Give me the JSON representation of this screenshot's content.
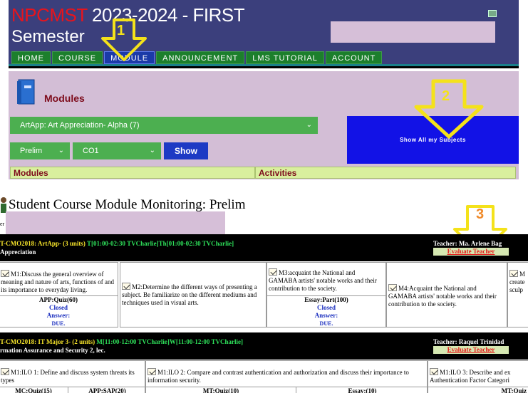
{
  "header": {
    "brand": "NPCMST",
    "title_rest": " 2023-2024 - FIRST",
    "title_line2": "Semester"
  },
  "nav": {
    "items": [
      {
        "label": "HOME",
        "active": false
      },
      {
        "label": "COURSE",
        "active": false
      },
      {
        "label": "MODULE",
        "active": true
      },
      {
        "label": "ANNOUNCEMENT",
        "active": false
      },
      {
        "label": "LMS TUTORIAL",
        "active": false
      },
      {
        "label": "ACCOUNT",
        "active": false
      }
    ]
  },
  "annotations": {
    "one": "1",
    "two": "2",
    "three": "3"
  },
  "modules_panel": {
    "title": "Modules",
    "subject_select": "ArtApp: Art Appreciation- Alpha (7)",
    "term_select": "Prelim",
    "co_select": "CO1",
    "show_button": "Show",
    "show_all_button": "Show All my Subjects",
    "col_modules": "Modules",
    "col_activities": "Activities"
  },
  "monitoring": {
    "title": "Student Course Module Monitoring: Prelim",
    "label_fragment": "er"
  },
  "courses": [
    {
      "code": "T-CMO2018: ArtApp- (3 units) ",
      "schedule": "T[01:00-02:30 TVCharlie]Th[01:00-02:30 TVCharlie]",
      "name": "Appreciation",
      "teacher": "Teacher: Ma. Arlene Bag",
      "evaluate": "Evaluate Teacher",
      "cards": [
        {
          "text": "M1:Discuss the general overview of meaning and nature of arts, functions of and its importance to everyday living.",
          "activity": "APP:Quiz(60)",
          "status": "Closed",
          "answer_label": "Answer:",
          "answer": "DUE."
        },
        {
          "text": "M2:Determine the different ways of presenting a subject. Be familiarize on the different mediums and techniques used in visual arts."
        },
        {
          "text": "M3:acquaint the National and GAMABA artists' notable works and their contribution to the society.",
          "activity": "Essay:Part(100)",
          "status": "Closed",
          "answer_label": "Answer:",
          "answer": "DUE."
        },
        {
          "text": "M4:Acquaint the National and GAMABA artists' notable works and their contribution to the society."
        },
        {
          "text": "M create sculp"
        }
      ]
    },
    {
      "code": "T-CMO2018: IT Major 3- (2 units) ",
      "schedule": "M[11:00-12:00 TVCharlie]W[11:00-12:00 TVCharlie]",
      "name": "rmation Assurance and Security 2, lec.",
      "teacher": "Teacher: Raquel Trinidad",
      "evaluate": "Evaluate Teacher",
      "cards": [
        {
          "text": "M1:ILO 1: Define and discuss system threats its types",
          "act_a": "MC:Quiz(15)",
          "act_b": "APP:SAP(20)"
        },
        {
          "text": "M1:ILO 2: Compare and contrast authentication and authorization and discuss their importance to information security.",
          "act_a": "MT:Quiz(10)",
          "act_b": "Essay:(10)"
        },
        {
          "text": "M1:ILO 3: Describe and ex Authentication Factor Categori",
          "act_a": "MT:Quiz"
        }
      ]
    }
  ]
}
